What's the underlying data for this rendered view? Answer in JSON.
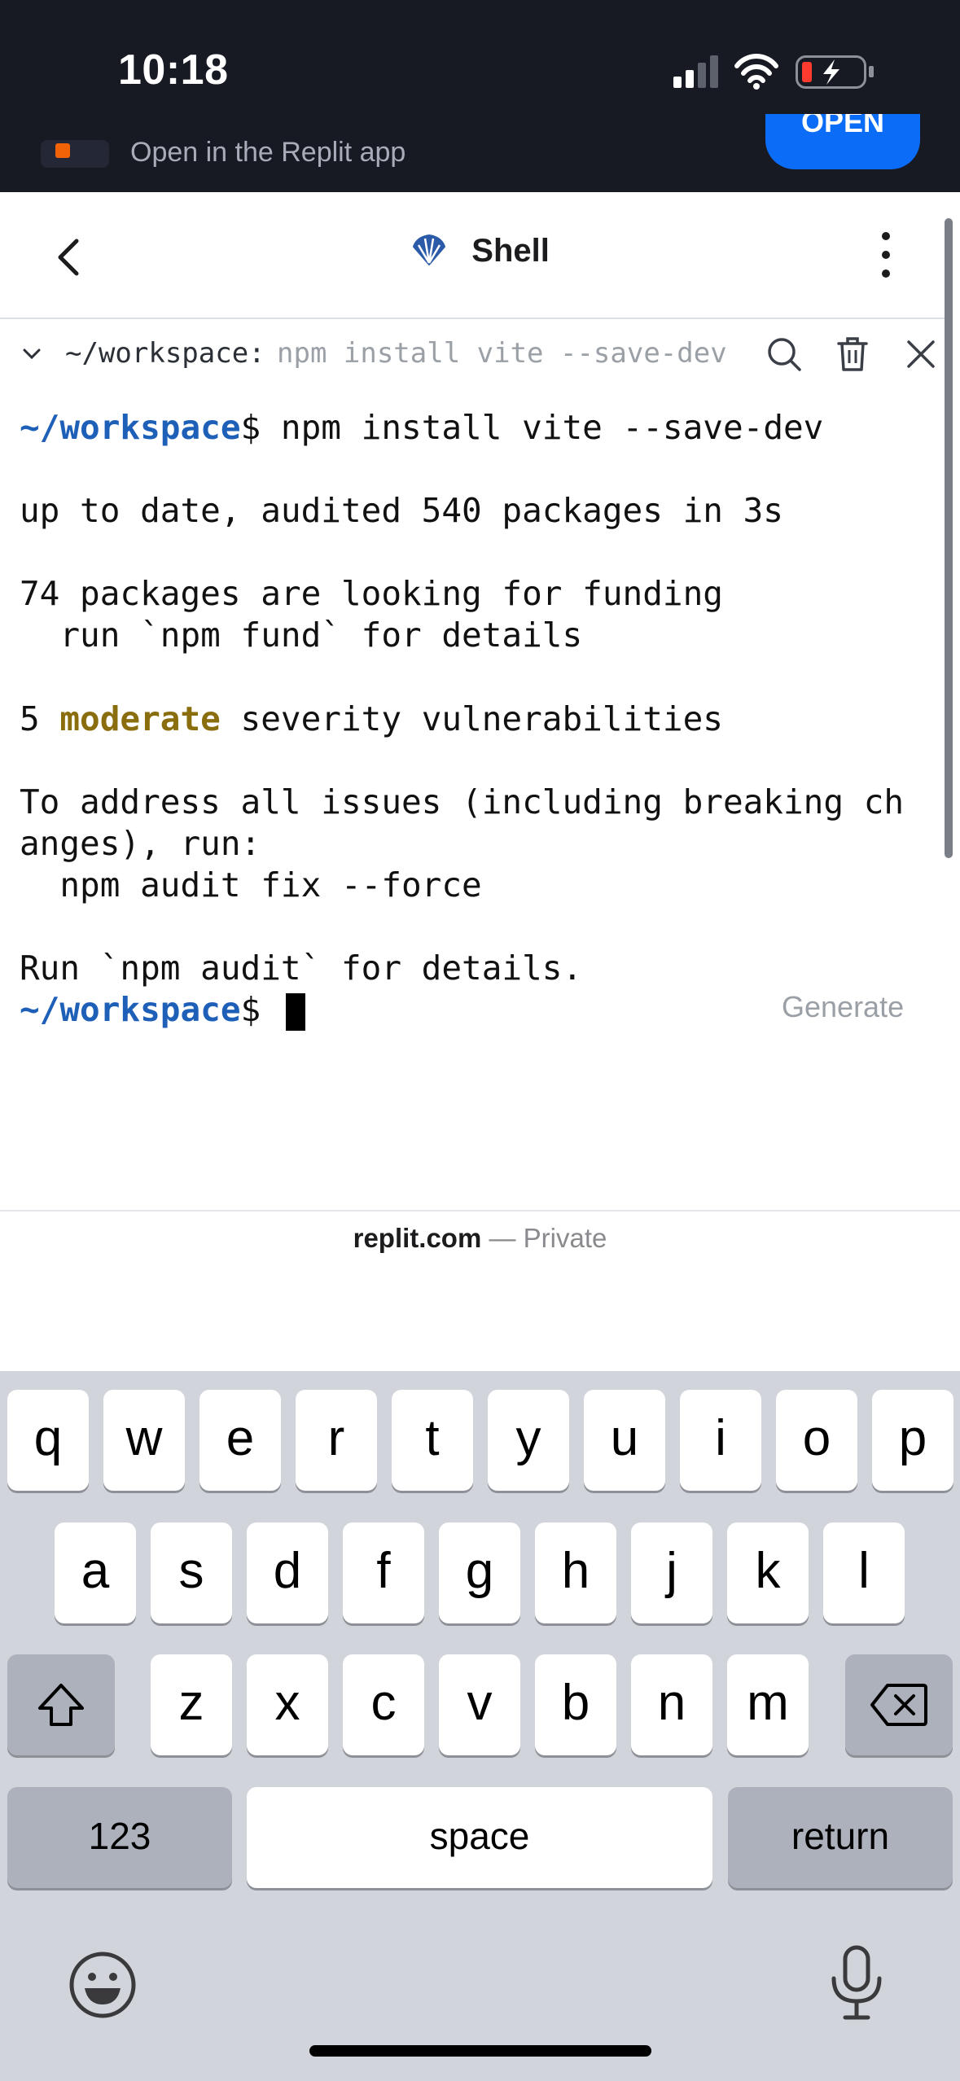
{
  "status_bar": {
    "time": "10:18",
    "icons": [
      "cellular-signal-icon",
      "wifi-icon",
      "battery-charging-icon"
    ]
  },
  "banner": {
    "text": "Open in the Replit app",
    "open_label": "OPEN",
    "brand_color": "#f26207",
    "button_color": "#0b6cf8"
  },
  "header": {
    "title": "Shell",
    "icon": "shell-icon"
  },
  "shell_bar": {
    "path": "~/workspace:",
    "command": "npm install vite --save-dev"
  },
  "terminal": {
    "prompt": "~/workspace",
    "prompt_color": "#1e5fb8",
    "lines": {
      "cmd": "$ npm install vite --save-dev",
      "up_to_date": "up to date, audited 540 packages in 3s",
      "funding": "74 packages are looking for funding",
      "fund_hint": "  run `npm fund` for details",
      "vuln_count": "5 ",
      "vuln_level": "moderate",
      "vuln_rest": " severity vulnerabilities",
      "address1": "To address all issues (including breaking ch",
      "address2": "anges), run:",
      "fix_cmd": "  npm audit fix --force",
      "audit_hint": "Run `npm audit` for details.",
      "prompt_end": "$ "
    },
    "generate_label": "Generate"
  },
  "address_bar": {
    "domain": "replit.com",
    "separator": " — ",
    "privacy": "Private"
  },
  "keyboard": {
    "row1": [
      "q",
      "w",
      "e",
      "r",
      "t",
      "y",
      "u",
      "i",
      "o",
      "p"
    ],
    "row2": [
      "a",
      "s",
      "d",
      "f",
      "g",
      "h",
      "j",
      "k",
      "l"
    ],
    "row3": [
      "z",
      "x",
      "c",
      "v",
      "b",
      "n",
      "m"
    ],
    "numbers_label": "123",
    "space_label": "space",
    "return_label": "return"
  }
}
